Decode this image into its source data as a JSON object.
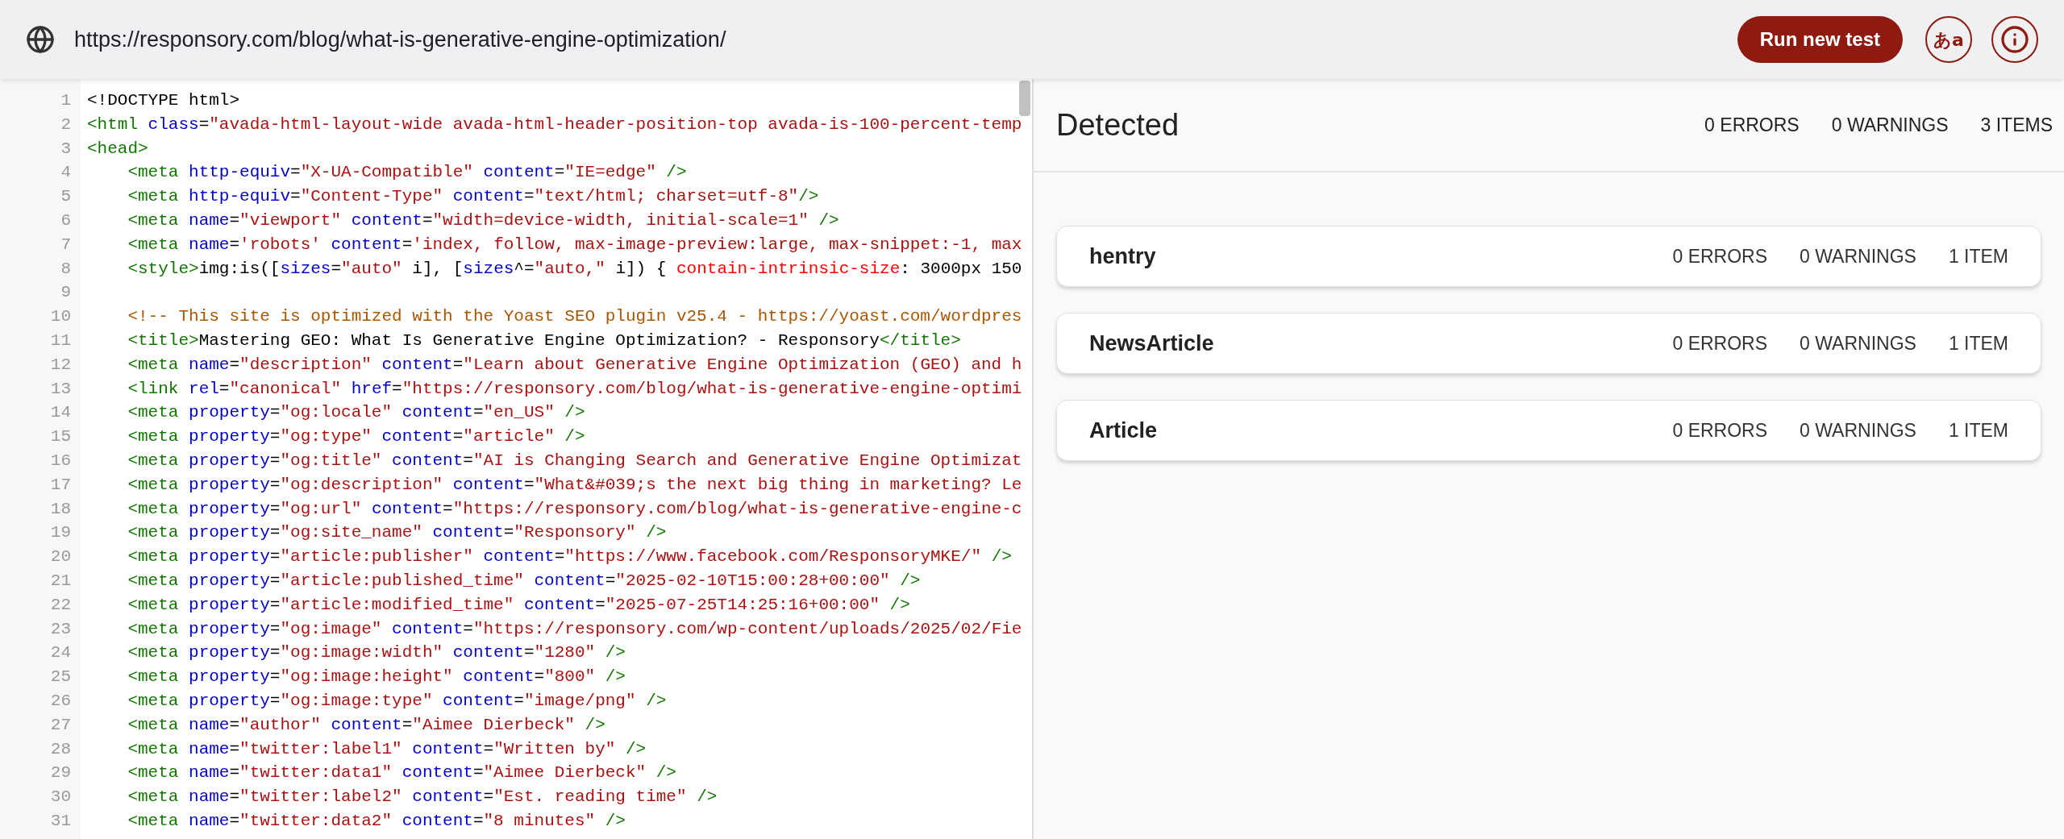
{
  "toolbar": {
    "url": "https://responsory.com/blog/what-is-generative-engine-optimization/",
    "run_button": "Run new test",
    "language_button": "あa"
  },
  "code": {
    "lines": [
      {
        "number": "1",
        "tokens": [
          {
            "kind": "plain",
            "text": "<!DOCTYPE html>"
          }
        ]
      },
      {
        "number": "2",
        "tokens": [
          {
            "kind": "tag",
            "text": "<html"
          },
          {
            "kind": "attr",
            "text": " class"
          },
          {
            "kind": "plain",
            "text": "="
          },
          {
            "kind": "string",
            "text": "\"avada-html-layout-wide avada-html-header-position-top avada-is-100-percent-temp"
          }
        ]
      },
      {
        "number": "3",
        "tokens": [
          {
            "kind": "tag",
            "text": "<head>"
          }
        ]
      },
      {
        "number": "4",
        "tokens": [
          {
            "kind": "tag",
            "text": "    <meta"
          },
          {
            "kind": "attr",
            "text": " http-equiv"
          },
          {
            "kind": "plain",
            "text": "="
          },
          {
            "kind": "string",
            "text": "\"X-UA-Compatible\""
          },
          {
            "kind": "attr",
            "text": " content"
          },
          {
            "kind": "plain",
            "text": "="
          },
          {
            "kind": "string",
            "text": "\"IE=edge\""
          },
          {
            "kind": "tag",
            "text": " />"
          }
        ]
      },
      {
        "number": "5",
        "tokens": [
          {
            "kind": "tag",
            "text": "    <meta"
          },
          {
            "kind": "attr",
            "text": " http-equiv"
          },
          {
            "kind": "plain",
            "text": "="
          },
          {
            "kind": "string",
            "text": "\"Content-Type\""
          },
          {
            "kind": "attr",
            "text": " content"
          },
          {
            "kind": "plain",
            "text": "="
          },
          {
            "kind": "string",
            "text": "\"text/html; charset=utf-8\""
          },
          {
            "kind": "tag",
            "text": "/>"
          }
        ]
      },
      {
        "number": "6",
        "tokens": [
          {
            "kind": "tag",
            "text": "    <meta"
          },
          {
            "kind": "attr",
            "text": " name"
          },
          {
            "kind": "plain",
            "text": "="
          },
          {
            "kind": "string",
            "text": "\"viewport\""
          },
          {
            "kind": "attr",
            "text": " content"
          },
          {
            "kind": "plain",
            "text": "="
          },
          {
            "kind": "string",
            "text": "\"width=device-width, initial-scale=1\""
          },
          {
            "kind": "tag",
            "text": " />"
          }
        ]
      },
      {
        "number": "7",
        "tokens": [
          {
            "kind": "tag",
            "text": "    <meta"
          },
          {
            "kind": "attr",
            "text": " name"
          },
          {
            "kind": "plain",
            "text": "="
          },
          {
            "kind": "string",
            "text": "'robots'"
          },
          {
            "kind": "attr",
            "text": " content"
          },
          {
            "kind": "plain",
            "text": "="
          },
          {
            "kind": "string",
            "text": "'index, follow, max-image-preview:large, max-snippet:-1, max"
          }
        ]
      },
      {
        "number": "8",
        "tokens": [
          {
            "kind": "tag",
            "text": "    <style>"
          },
          {
            "kind": "plain",
            "text": "img:is(["
          },
          {
            "kind": "attr",
            "text": "sizes"
          },
          {
            "kind": "plain",
            "text": "="
          },
          {
            "kind": "string",
            "text": "\"auto\""
          },
          {
            "kind": "plain",
            "text": " i], ["
          },
          {
            "kind": "attr",
            "text": "sizes"
          },
          {
            "kind": "plain",
            "text": "^="
          },
          {
            "kind": "string",
            "text": "\"auto,\""
          },
          {
            "kind": "plain",
            "text": " i]) { "
          },
          {
            "kind": "property",
            "text": "contain-intrinsic-size"
          },
          {
            "kind": "plain",
            "text": ": 3000px 150"
          }
        ]
      },
      {
        "number": "9"
      },
      {
        "number": "10",
        "tokens": [
          {
            "kind": "comment",
            "text": "    <!-- This site is optimized with the Yoast SEO plugin v25.4 - https://yoast.com/wordpres"
          }
        ]
      },
      {
        "number": "11",
        "tokens": [
          {
            "kind": "tag",
            "text": "    <title>"
          },
          {
            "kind": "plain",
            "text": "Mastering GEO: What Is Generative Engine Optimization? - Responsory"
          },
          {
            "kind": "tag",
            "text": "</title>"
          }
        ]
      },
      {
        "number": "12",
        "tokens": [
          {
            "kind": "tag",
            "text": "    <meta"
          },
          {
            "kind": "attr",
            "text": " name"
          },
          {
            "kind": "plain",
            "text": "="
          },
          {
            "kind": "string",
            "text": "\"description\""
          },
          {
            "kind": "attr",
            "text": " content"
          },
          {
            "kind": "plain",
            "text": "="
          },
          {
            "kind": "string",
            "text": "\"Learn about Generative Engine Optimization (GEO) and h"
          }
        ]
      },
      {
        "number": "13",
        "tokens": [
          {
            "kind": "tag",
            "text": "    <link"
          },
          {
            "kind": "attr",
            "text": " rel"
          },
          {
            "kind": "plain",
            "text": "="
          },
          {
            "kind": "string",
            "text": "\"canonical\""
          },
          {
            "kind": "attr",
            "text": " href"
          },
          {
            "kind": "plain",
            "text": "="
          },
          {
            "kind": "string",
            "text": "\"https://responsory.com/blog/what-is-generative-engine-optimi"
          }
        ]
      },
      {
        "number": "14",
        "tokens": [
          {
            "kind": "tag",
            "text": "    <meta"
          },
          {
            "kind": "attr",
            "text": " property"
          },
          {
            "kind": "plain",
            "text": "="
          },
          {
            "kind": "string",
            "text": "\"og:locale\""
          },
          {
            "kind": "attr",
            "text": " content"
          },
          {
            "kind": "plain",
            "text": "="
          },
          {
            "kind": "string",
            "text": "\"en_US\""
          },
          {
            "kind": "tag",
            "text": " />"
          }
        ]
      },
      {
        "number": "15",
        "tokens": [
          {
            "kind": "tag",
            "text": "    <meta"
          },
          {
            "kind": "attr",
            "text": " property"
          },
          {
            "kind": "plain",
            "text": "="
          },
          {
            "kind": "string",
            "text": "\"og:type\""
          },
          {
            "kind": "attr",
            "text": " content"
          },
          {
            "kind": "plain",
            "text": "="
          },
          {
            "kind": "string",
            "text": "\"article\""
          },
          {
            "kind": "tag",
            "text": " />"
          }
        ]
      },
      {
        "number": "16",
        "tokens": [
          {
            "kind": "tag",
            "text": "    <meta"
          },
          {
            "kind": "attr",
            "text": " property"
          },
          {
            "kind": "plain",
            "text": "="
          },
          {
            "kind": "string",
            "text": "\"og:title\""
          },
          {
            "kind": "attr",
            "text": " content"
          },
          {
            "kind": "plain",
            "text": "="
          },
          {
            "kind": "string",
            "text": "\"AI is Changing Search and Generative Engine Optimizat"
          }
        ]
      },
      {
        "number": "17",
        "tokens": [
          {
            "kind": "tag",
            "text": "    <meta"
          },
          {
            "kind": "attr",
            "text": " property"
          },
          {
            "kind": "plain",
            "text": "="
          },
          {
            "kind": "string",
            "text": "\"og:description\""
          },
          {
            "kind": "attr",
            "text": " content"
          },
          {
            "kind": "plain",
            "text": "="
          },
          {
            "kind": "string",
            "text": "\"What&#039;s the next big thing in marketing? Le"
          }
        ]
      },
      {
        "number": "18",
        "tokens": [
          {
            "kind": "tag",
            "text": "    <meta"
          },
          {
            "kind": "attr",
            "text": " property"
          },
          {
            "kind": "plain",
            "text": "="
          },
          {
            "kind": "string",
            "text": "\"og:url\""
          },
          {
            "kind": "attr",
            "text": " content"
          },
          {
            "kind": "plain",
            "text": "="
          },
          {
            "kind": "string",
            "text": "\"https://responsory.com/blog/what-is-generative-engine-c"
          }
        ]
      },
      {
        "number": "19",
        "tokens": [
          {
            "kind": "tag",
            "text": "    <meta"
          },
          {
            "kind": "attr",
            "text": " property"
          },
          {
            "kind": "plain",
            "text": "="
          },
          {
            "kind": "string",
            "text": "\"og:site_name\""
          },
          {
            "kind": "attr",
            "text": " content"
          },
          {
            "kind": "plain",
            "text": "="
          },
          {
            "kind": "string",
            "text": "\"Responsory\""
          },
          {
            "kind": "tag",
            "text": " />"
          }
        ]
      },
      {
        "number": "20",
        "tokens": [
          {
            "kind": "tag",
            "text": "    <meta"
          },
          {
            "kind": "attr",
            "text": " property"
          },
          {
            "kind": "plain",
            "text": "="
          },
          {
            "kind": "string",
            "text": "\"article:publisher\""
          },
          {
            "kind": "attr",
            "text": " content"
          },
          {
            "kind": "plain",
            "text": "="
          },
          {
            "kind": "string",
            "text": "\"https://www.facebook.com/ResponsoryMKE/\""
          },
          {
            "kind": "tag",
            "text": " />"
          }
        ]
      },
      {
        "number": "21",
        "tokens": [
          {
            "kind": "tag",
            "text": "    <meta"
          },
          {
            "kind": "attr",
            "text": " property"
          },
          {
            "kind": "plain",
            "text": "="
          },
          {
            "kind": "string",
            "text": "\"article:published_time\""
          },
          {
            "kind": "attr",
            "text": " content"
          },
          {
            "kind": "plain",
            "text": "="
          },
          {
            "kind": "string",
            "text": "\"2025-02-10T15:00:28+00:00\""
          },
          {
            "kind": "tag",
            "text": " />"
          }
        ]
      },
      {
        "number": "22",
        "tokens": [
          {
            "kind": "tag",
            "text": "    <meta"
          },
          {
            "kind": "attr",
            "text": " property"
          },
          {
            "kind": "plain",
            "text": "="
          },
          {
            "kind": "string",
            "text": "\"article:modified_time\""
          },
          {
            "kind": "attr",
            "text": " content"
          },
          {
            "kind": "plain",
            "text": "="
          },
          {
            "kind": "string",
            "text": "\"2025-07-25T14:25:16+00:00\""
          },
          {
            "kind": "tag",
            "text": " />"
          }
        ]
      },
      {
        "number": "23",
        "tokens": [
          {
            "kind": "tag",
            "text": "    <meta"
          },
          {
            "kind": "attr",
            "text": " property"
          },
          {
            "kind": "plain",
            "text": "="
          },
          {
            "kind": "string",
            "text": "\"og:image\""
          },
          {
            "kind": "attr",
            "text": " content"
          },
          {
            "kind": "plain",
            "text": "="
          },
          {
            "kind": "string",
            "text": "\"https://responsory.com/wp-content/uploads/2025/02/Fie"
          }
        ]
      },
      {
        "number": "24",
        "tokens": [
          {
            "kind": "tag",
            "text": "    <meta"
          },
          {
            "kind": "attr",
            "text": " property"
          },
          {
            "kind": "plain",
            "text": "="
          },
          {
            "kind": "string",
            "text": "\"og:image:width\""
          },
          {
            "kind": "attr",
            "text": " content"
          },
          {
            "kind": "plain",
            "text": "="
          },
          {
            "kind": "string",
            "text": "\"1280\""
          },
          {
            "kind": "tag",
            "text": " />"
          }
        ]
      },
      {
        "number": "25",
        "tokens": [
          {
            "kind": "tag",
            "text": "    <meta"
          },
          {
            "kind": "attr",
            "text": " property"
          },
          {
            "kind": "plain",
            "text": "="
          },
          {
            "kind": "string",
            "text": "\"og:image:height\""
          },
          {
            "kind": "attr",
            "text": " content"
          },
          {
            "kind": "plain",
            "text": "="
          },
          {
            "kind": "string",
            "text": "\"800\""
          },
          {
            "kind": "tag",
            "text": " />"
          }
        ]
      },
      {
        "number": "26",
        "tokens": [
          {
            "kind": "tag",
            "text": "    <meta"
          },
          {
            "kind": "attr",
            "text": " property"
          },
          {
            "kind": "plain",
            "text": "="
          },
          {
            "kind": "string",
            "text": "\"og:image:type\""
          },
          {
            "kind": "attr",
            "text": " content"
          },
          {
            "kind": "plain",
            "text": "="
          },
          {
            "kind": "string",
            "text": "\"image/png\""
          },
          {
            "kind": "tag",
            "text": " />"
          }
        ]
      },
      {
        "number": "27",
        "tokens": [
          {
            "kind": "tag",
            "text": "    <meta"
          },
          {
            "kind": "attr",
            "text": " name"
          },
          {
            "kind": "plain",
            "text": "="
          },
          {
            "kind": "string",
            "text": "\"author\""
          },
          {
            "kind": "attr",
            "text": " content"
          },
          {
            "kind": "plain",
            "text": "="
          },
          {
            "kind": "string",
            "text": "\"Aimee Dierbeck\""
          },
          {
            "kind": "tag",
            "text": " />"
          }
        ]
      },
      {
        "number": "28",
        "tokens": [
          {
            "kind": "tag",
            "text": "    <meta"
          },
          {
            "kind": "attr",
            "text": " name"
          },
          {
            "kind": "plain",
            "text": "="
          },
          {
            "kind": "string",
            "text": "\"twitter:label1\""
          },
          {
            "kind": "attr",
            "text": " content"
          },
          {
            "kind": "plain",
            "text": "="
          },
          {
            "kind": "string",
            "text": "\"Written by\""
          },
          {
            "kind": "tag",
            "text": " />"
          }
        ]
      },
      {
        "number": "29",
        "tokens": [
          {
            "kind": "tag",
            "text": "    <meta"
          },
          {
            "kind": "attr",
            "text": " name"
          },
          {
            "kind": "plain",
            "text": "="
          },
          {
            "kind": "string",
            "text": "\"twitter:data1\""
          },
          {
            "kind": "attr",
            "text": " content"
          },
          {
            "kind": "plain",
            "text": "="
          },
          {
            "kind": "string",
            "text": "\"Aimee Dierbeck\""
          },
          {
            "kind": "tag",
            "text": " />"
          }
        ]
      },
      {
        "number": "30",
        "tokens": [
          {
            "kind": "tag",
            "text": "    <meta"
          },
          {
            "kind": "attr",
            "text": " name"
          },
          {
            "kind": "plain",
            "text": "="
          },
          {
            "kind": "string",
            "text": "\"twitter:label2\""
          },
          {
            "kind": "attr",
            "text": " content"
          },
          {
            "kind": "plain",
            "text": "="
          },
          {
            "kind": "string",
            "text": "\"Est. reading time\""
          },
          {
            "kind": "tag",
            "text": " />"
          }
        ]
      },
      {
        "number": "31",
        "tokens": [
          {
            "kind": "tag",
            "text": "    <meta"
          },
          {
            "kind": "attr",
            "text": " name"
          },
          {
            "kind": "plain",
            "text": "="
          },
          {
            "kind": "string",
            "text": "\"twitter:data2\""
          },
          {
            "kind": "attr",
            "text": " content"
          },
          {
            "kind": "plain",
            "text": "="
          },
          {
            "kind": "string",
            "text": "\"8 minutes\""
          },
          {
            "kind": "tag",
            "text": " />"
          }
        ]
      }
    ]
  },
  "results": {
    "title": "Detected",
    "errors": "0 ERRORS",
    "warnings": "0 WARNINGS",
    "items": "3 ITEMS",
    "types": [
      {
        "name": "hentry",
        "errors": "0 ERRORS",
        "warnings": "0 WARNINGS",
        "items": "1 ITEM"
      },
      {
        "name": "NewsArticle",
        "errors": "0 ERRORS",
        "warnings": "0 WARNINGS",
        "items": "1 ITEM"
      },
      {
        "name": "Article",
        "errors": "0 ERRORS",
        "warnings": "0 WARNINGS",
        "items": "1 ITEM"
      }
    ]
  }
}
